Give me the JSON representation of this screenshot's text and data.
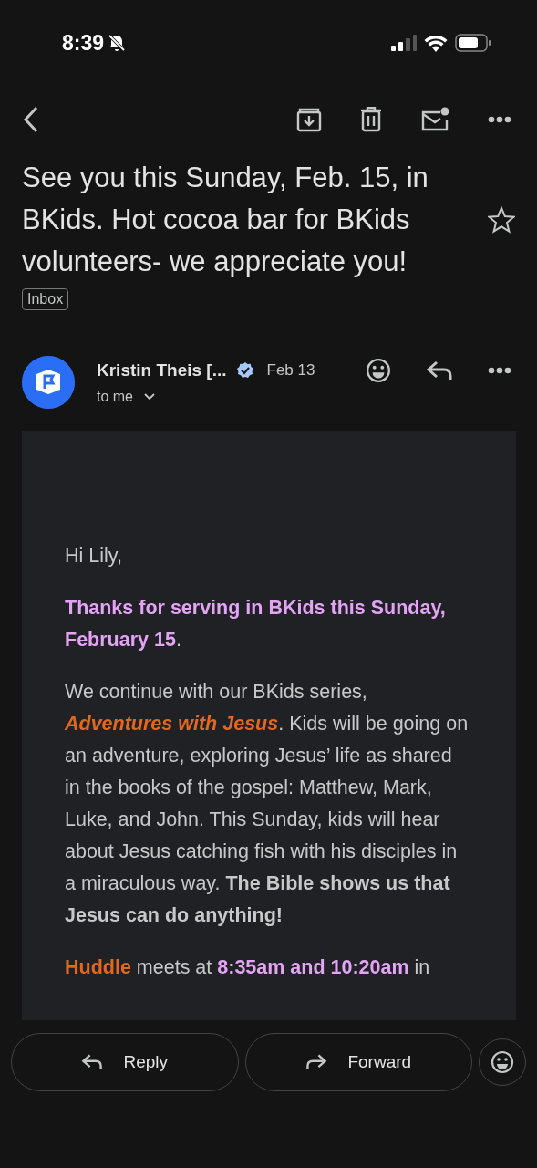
{
  "status_bar": {
    "time": "8:39"
  },
  "subject": {
    "text": "See you this Sunday, Feb. 15, in BKids.  Hot cocoa bar for BKids volunteers- we appreciate you!",
    "starred": false,
    "label": "Inbox"
  },
  "message": {
    "sender": "Kristin Theis [...",
    "verified": true,
    "date": "Feb 13",
    "recipient": "to me",
    "paragraphs": [
      [
        {
          "kind": "plain",
          "text": "Hi Lily,"
        }
      ],
      [
        {
          "kind": "highlight",
          "text": "Thanks for serving in BKids this Sunday, February 15"
        },
        {
          "kind": "plain",
          "text": "."
        }
      ],
      [
        {
          "kind": "plain",
          "text": "We continue with our BKids series, "
        },
        {
          "kind": "title",
          "text": "Adventures with Jesus"
        },
        {
          "kind": "plain",
          "text": ". Kids will be going on an adventure, exploring Jesus’ life as shared in the books of the gospel: Matthew, Mark, Luke, and John. This Sunday, kids will hear about Jesus catching fish with his disciples in a miraculous way. "
        },
        {
          "kind": "strong",
          "text": "The Bible shows us that Jesus can do anything!"
        }
      ],
      [
        {
          "kind": "accent",
          "text": "Huddle"
        },
        {
          "kind": "plain",
          "text": " meets at "
        },
        {
          "kind": "highlight",
          "text": "8:35am and 10:20am"
        },
        {
          "kind": "plain",
          "text": " in"
        }
      ]
    ]
  },
  "actions": [
    {
      "kind": "reply",
      "label": "Reply"
    },
    {
      "kind": "forward",
      "label": "Forward"
    }
  ]
}
